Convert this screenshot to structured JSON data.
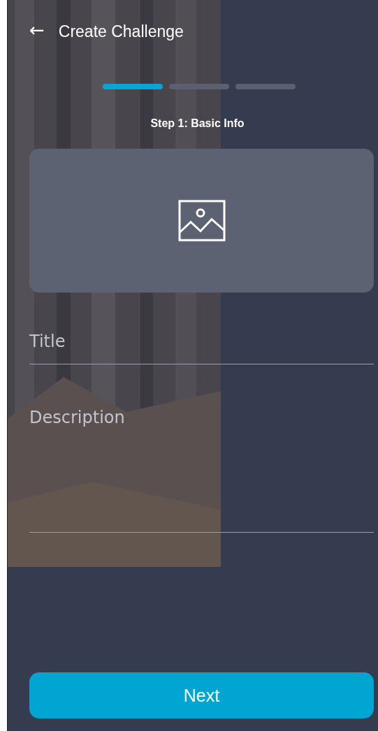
{
  "header": {
    "back_icon": "←",
    "title": "Create Challenge"
  },
  "steps": [
    {
      "selected": true
    },
    {
      "selected": false
    },
    {
      "selected": false
    }
  ],
  "step_label": "Step 1: Basic Info",
  "fields": [
    {
      "kind": "single",
      "placeholder": "Title"
    },
    {
      "kind": "multiline",
      "placeholder": "Description"
    }
  ],
  "button": "Next"
}
